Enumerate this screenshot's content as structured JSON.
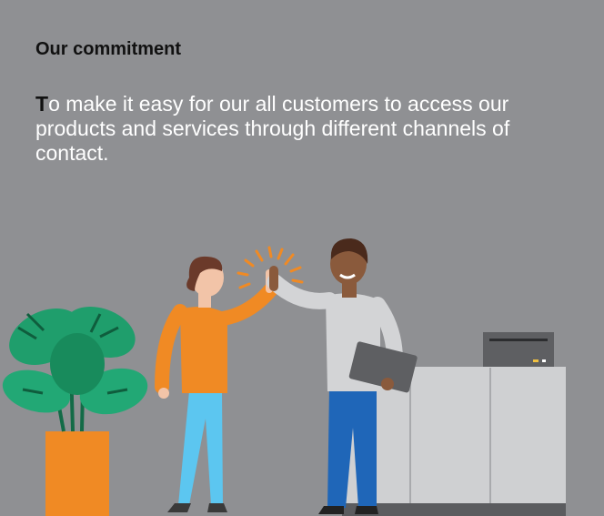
{
  "card": {
    "heading": "Our commitment",
    "body_lead": "T",
    "body_rest": "o make it easy for our all customers to access our products and services through different channels of contact."
  },
  "illustration": {
    "subject": "two people high-fiving next to a potted plant and office printer"
  },
  "colors": {
    "background": "#8f9093",
    "accent_orange": "#f08a24",
    "plant_green": "#1f9e6c",
    "trousers_blue": "#1f66b8",
    "light_blue": "#5cc6f0"
  }
}
